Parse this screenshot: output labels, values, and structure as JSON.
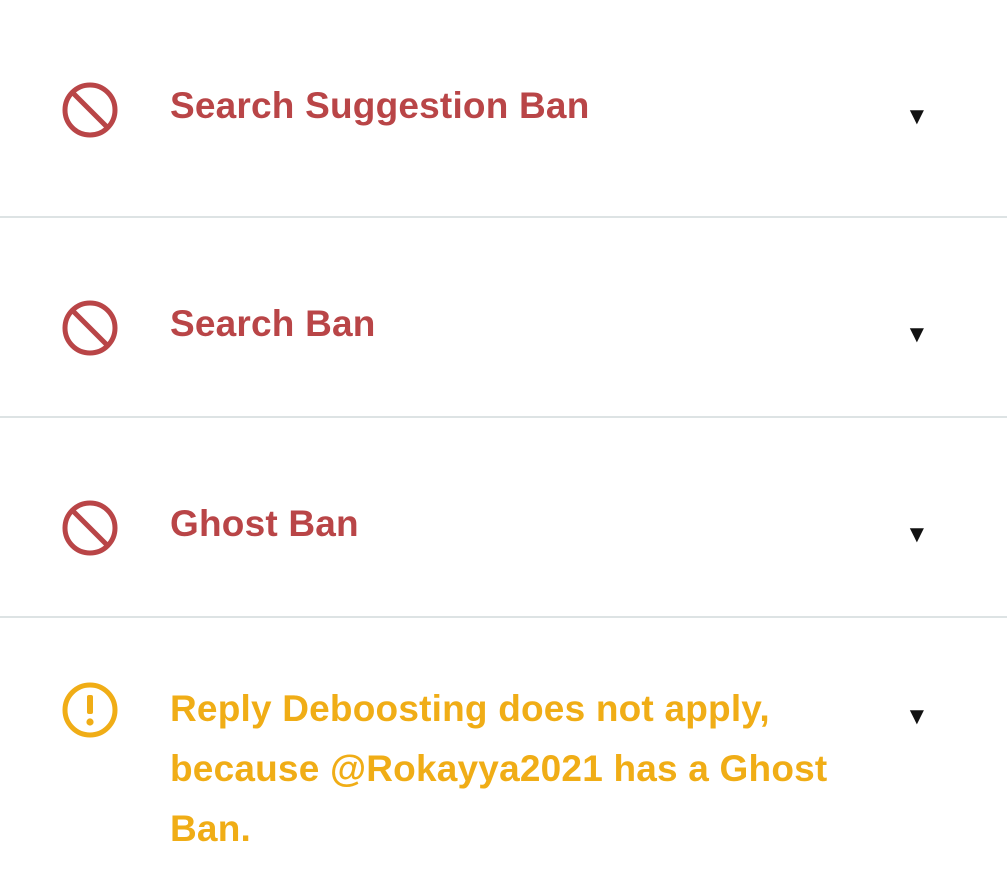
{
  "colors": {
    "ban_red": "#b94547",
    "warning_amber": "#f0ad16",
    "divider": "#dde3e4",
    "caret": "#111111"
  },
  "items": [
    {
      "icon": "ban-icon",
      "label": "Search Suggestion Ban",
      "caret": "▼",
      "status": "ban"
    },
    {
      "icon": "ban-icon",
      "label": "Search Ban",
      "caret": "▼",
      "status": "ban"
    },
    {
      "icon": "ban-icon",
      "label": "Ghost Ban",
      "caret": "▼",
      "status": "ban"
    },
    {
      "icon": "warning-icon",
      "label": "Reply Deboosting does not apply, because @Rokayya2021 has a Ghost Ban.",
      "caret": "▼",
      "status": "warning"
    }
  ]
}
